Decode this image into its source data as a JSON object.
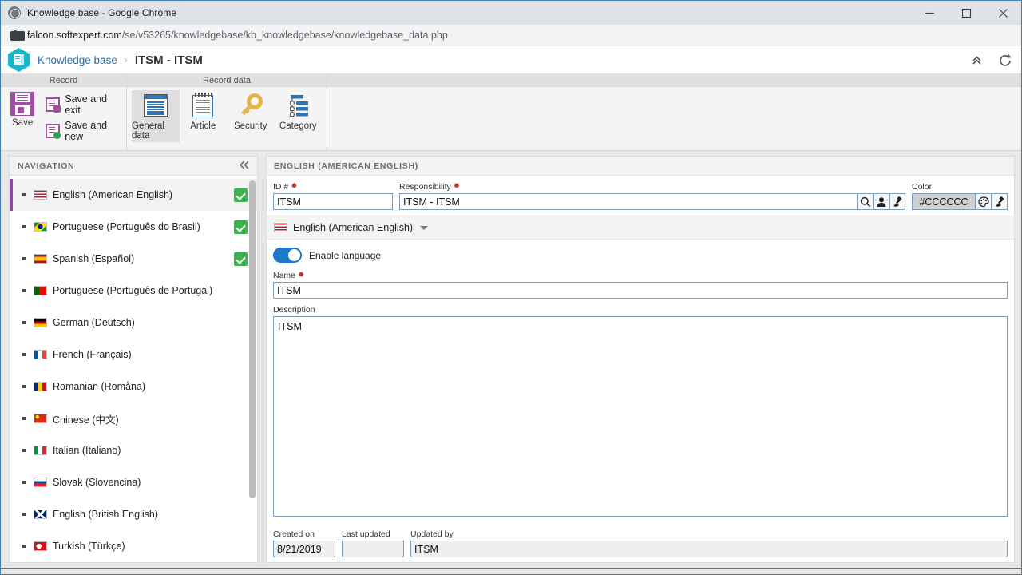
{
  "browser": {
    "window_title": "Knowledge base - Google Chrome",
    "url_host": "falcon.softexpert.com",
    "url_path": "/se/v53265/knowledgebase/kb_knowledgebase/knowledgebase_data.php",
    "controls": {
      "minimize": "minimize-icon",
      "maximize": "maximize-icon",
      "close": "close-icon"
    },
    "favicon": "globe-icon",
    "lock": "lock-icon"
  },
  "app_header": {
    "logo": "knowledge-base-logo",
    "breadcrumb_link": "Knowledge base",
    "breadcrumb_separator": "›",
    "title": "ITSM - ITSM",
    "collapse_icon": "chevron-up-double-icon",
    "refresh_icon": "refresh-icon"
  },
  "ribbon": {
    "groups": [
      {
        "title": "Record"
      },
      {
        "title": "Record data"
      },
      {
        "title": ""
      }
    ],
    "save_button": "Save",
    "save_and_exit": "Save and exit",
    "save_and_new": "Save and new",
    "tabs": [
      {
        "label": "General data",
        "icon": "general-data-icon",
        "active": true
      },
      {
        "label": "Article",
        "icon": "article-icon",
        "active": false
      },
      {
        "label": "Security",
        "icon": "security-key-icon",
        "active": false
      },
      {
        "label": "Category",
        "icon": "category-tree-icon",
        "active": false
      }
    ]
  },
  "navigation": {
    "title": "NAVIGATION",
    "collapse_icon": "chevron-left-double-icon",
    "items": [
      {
        "label": "English (American English)",
        "flag": "us-flag",
        "enabled": true,
        "selected": true
      },
      {
        "label": "Portuguese (Português do Brasil)",
        "flag": "br-flag",
        "enabled": true,
        "selected": false
      },
      {
        "label": "Spanish (Español)",
        "flag": "es-flag",
        "enabled": true,
        "selected": false
      },
      {
        "label": "Portuguese (Português de Portugal)",
        "flag": "pt-flag",
        "enabled": false,
        "selected": false
      },
      {
        "label": "German (Deutsch)",
        "flag": "de-flag",
        "enabled": false,
        "selected": false
      },
      {
        "label": "French (Français)",
        "flag": "fr-flag",
        "enabled": false,
        "selected": false
      },
      {
        "label": "Romanian (Romåna)",
        "flag": "ro-flag",
        "enabled": false,
        "selected": false
      },
      {
        "label": "Chinese (中文)",
        "flag": "cn-flag",
        "enabled": false,
        "selected": false
      },
      {
        "label": "Italian (Italiano)",
        "flag": "it-flag",
        "enabled": false,
        "selected": false
      },
      {
        "label": "Slovak (Slovencina)",
        "flag": "sk-flag",
        "enabled": false,
        "selected": false
      },
      {
        "label": "English (British English)",
        "flag": "gb-flag",
        "enabled": false,
        "selected": false
      },
      {
        "label": "Turkish (Türkçe)",
        "flag": "tr-flag",
        "enabled": false,
        "selected": false
      }
    ]
  },
  "main": {
    "section_title": "ENGLISH (AMERICAN ENGLISH)",
    "id_label": "ID #",
    "id_value": "ITSM",
    "responsibility_label": "Responsibility",
    "responsibility_value": "ITSM - ITSM",
    "responsibility_buttons": [
      "search-icon",
      "user-icon",
      "eraser-icon"
    ],
    "color_label": "Color",
    "color_value": "#CCCCCC",
    "color_swatch": "#CCCCCC",
    "color_buttons": [
      "palette-icon",
      "eraser-icon"
    ],
    "language_selector": {
      "label": "English (American English)",
      "flag": "us-flag",
      "caret": "chevron-down-icon"
    },
    "enable_language_label": "Enable language",
    "enable_language_on": true,
    "name_label": "Name",
    "name_value": "ITSM",
    "description_label": "Description",
    "description_value": "ITSM",
    "created_on_label": "Created on",
    "created_on_value": "8/21/2019",
    "last_updated_label": "Last updated",
    "last_updated_value": "",
    "updated_by_label": "Updated by",
    "updated_by_value": "ITSM"
  },
  "theme": {
    "accent_purple": "#9e4f9e",
    "accent_blue": "#2e75b6",
    "toggle_on": "#1d78c8",
    "check_green": "#3cb44b",
    "window_border": "#3d7eb8",
    "required_marker": "#c0392b"
  }
}
